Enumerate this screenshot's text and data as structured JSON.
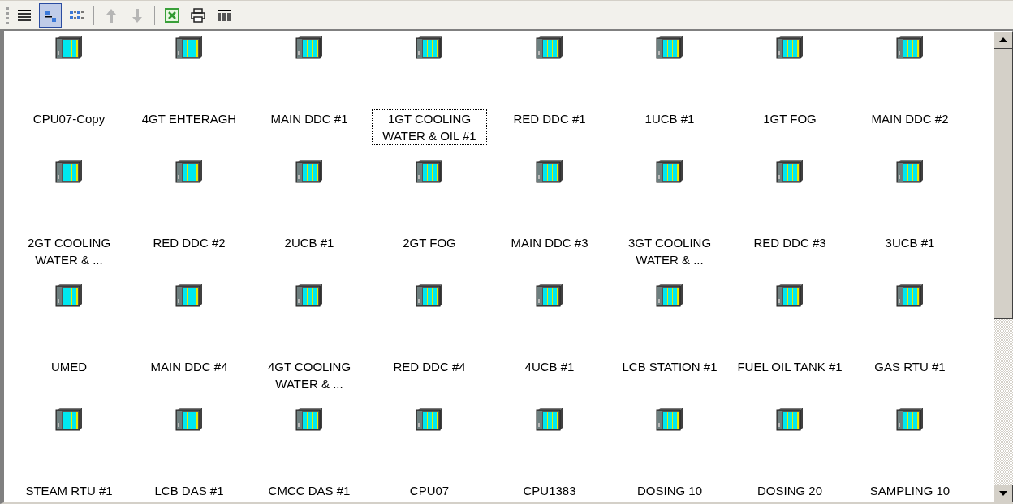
{
  "toolbar": [
    {
      "kind": "details",
      "selected": false,
      "disabled": false
    },
    {
      "kind": "large-icons",
      "selected": true,
      "disabled": false
    },
    {
      "kind": "list",
      "selected": false,
      "disabled": false
    },
    {
      "kind": "separator"
    },
    {
      "kind": "up",
      "selected": false,
      "disabled": true
    },
    {
      "kind": "down",
      "selected": false,
      "disabled": true
    },
    {
      "kind": "separator"
    },
    {
      "kind": "excel",
      "selected": false,
      "disabled": false
    },
    {
      "kind": "print",
      "selected": false,
      "disabled": false
    },
    {
      "kind": "columns",
      "selected": false,
      "disabled": false
    }
  ],
  "items": [
    {
      "label": "CPU07-Copy",
      "focused": false
    },
    {
      "label": "4GT EHTERAGH",
      "focused": false
    },
    {
      "label": "MAIN DDC #1",
      "focused": false
    },
    {
      "label": "1GT COOLING WATER & OIL #1",
      "focused": true
    },
    {
      "label": "RED DDC #1",
      "focused": false
    },
    {
      "label": "1UCB #1",
      "focused": false
    },
    {
      "label": "1GT FOG",
      "focused": false
    },
    {
      "label": "MAIN DDC #2",
      "focused": false
    },
    {
      "label": "2GT COOLING WATER & ...",
      "focused": false
    },
    {
      "label": "RED DDC #2",
      "focused": false
    },
    {
      "label": "2UCB #1",
      "focused": false
    },
    {
      "label": "2GT FOG",
      "focused": false
    },
    {
      "label": "MAIN DDC #3",
      "focused": false
    },
    {
      "label": "3GT COOLING WATER & ...",
      "focused": false
    },
    {
      "label": "RED DDC #3",
      "focused": false
    },
    {
      "label": "3UCB #1",
      "focused": false
    },
    {
      "label": "UMED",
      "focused": false
    },
    {
      "label": "MAIN DDC #4",
      "focused": false
    },
    {
      "label": "4GT COOLING WATER & ...",
      "focused": false
    },
    {
      "label": "RED DDC #4",
      "focused": false
    },
    {
      "label": "4UCB #1",
      "focused": false
    },
    {
      "label": "LCB STATION #1",
      "focused": false
    },
    {
      "label": "FUEL OIL TANK #1",
      "focused": false
    },
    {
      "label": "GAS RTU #1",
      "focused": false
    },
    {
      "label": "STEAM RTU #1",
      "focused": false
    },
    {
      "label": "LCB DAS #1",
      "focused": false
    },
    {
      "label": "CMCC DAS #1",
      "focused": false
    },
    {
      "label": "CPU07",
      "focused": false
    },
    {
      "label": "CPU1383",
      "focused": false
    },
    {
      "label": "DOSING 10",
      "focused": false
    },
    {
      "label": "DOSING 20",
      "focused": false
    },
    {
      "label": "SAMPLING 10",
      "focused": false
    }
  ]
}
